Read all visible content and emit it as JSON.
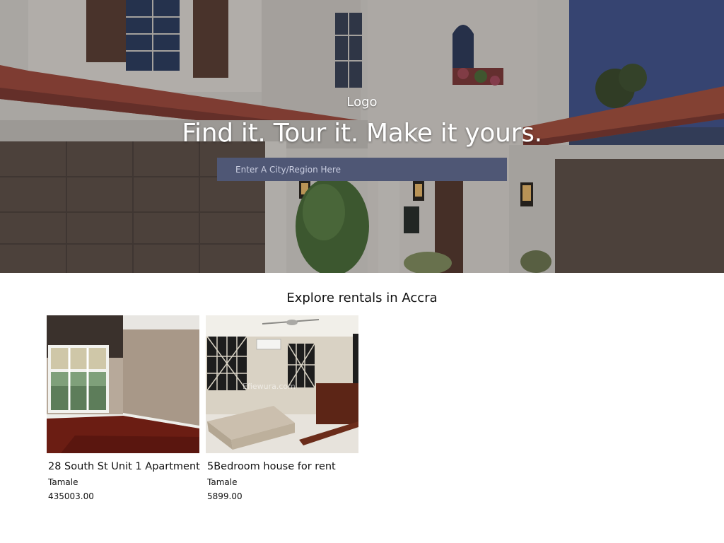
{
  "header": {
    "logo_text": "Logo",
    "headline": "Find it. Tour it. Make it yours."
  },
  "search": {
    "placeholder": "Enter A City/Region Here",
    "value": ""
  },
  "listings_section": {
    "title": "Explore rentals in Accra",
    "listings": [
      {
        "title": "28 South St Unit 1 Apartment",
        "city": "Tamale",
        "price": "435003.00"
      },
      {
        "title": "5Bedroom house for rent",
        "city": "Tamale",
        "price": "5899.00",
        "photo_watermark": "Efiewura.com"
      }
    ]
  },
  "colors": {
    "search_bg": "#4f5775",
    "hero_text": "#ffffff",
    "body_text": "#111111"
  }
}
